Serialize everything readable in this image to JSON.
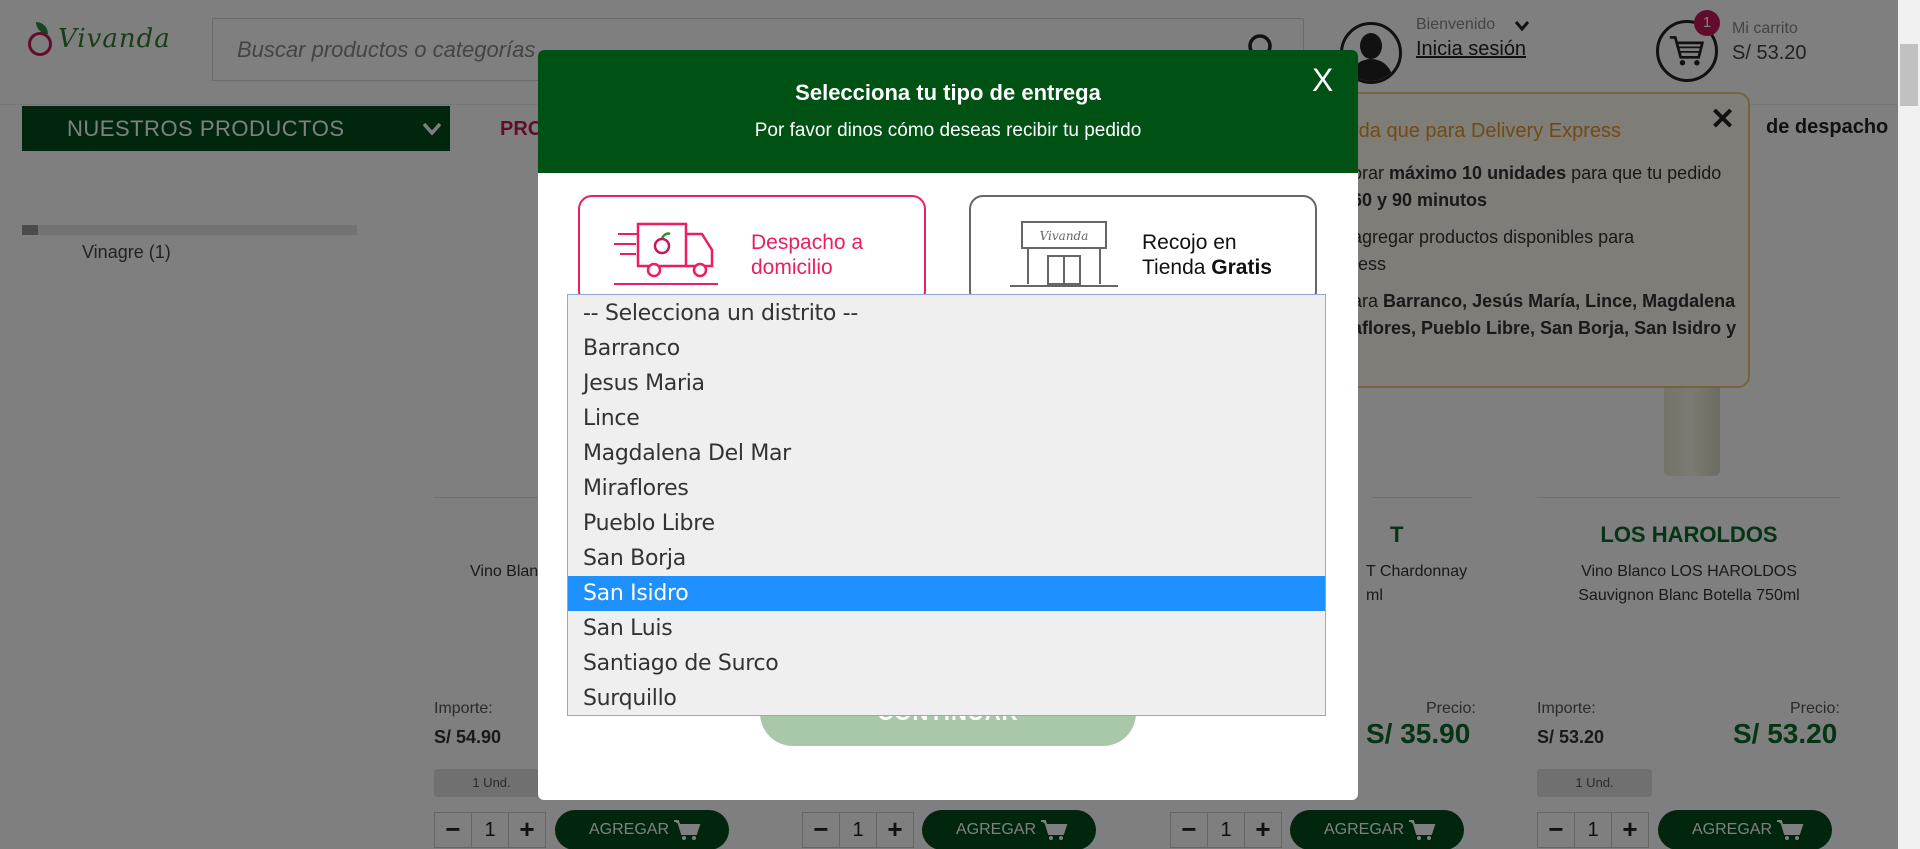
{
  "header": {
    "logo_text": "Vivanda",
    "search_placeholder": "Buscar productos o categorías",
    "welcome": "Bienvenido",
    "login": "Inicia sesión",
    "cart_label": "Mi carrito",
    "cart_total": "S/ 53.20",
    "cart_count": "1"
  },
  "nav": {
    "products_menu": "NUESTROS PRODUCTOS",
    "promo_link": "PRO",
    "dispatch_link": "de despacho"
  },
  "filters": {
    "vinagre": "Vinagre (1)"
  },
  "tooltip": {
    "title": "rda que para Delivery Express",
    "line1_a": "orar ",
    "line1_b": "máximo 10 unidades",
    "line1_c": " para que tu pedido",
    "line2": "60 y 90 minutos",
    "line3": "agregar productos disponibles para",
    "line4": "ress",
    "line5_a": "ara ",
    "line5_b": "Barranco, Jesús María, Lince, Magdalena",
    "line6": "aflores, Pueblo Libre, San Borja, San Isidro y"
  },
  "products": [
    {
      "brand": "",
      "name_line1": "Vino Blan",
      "name_line2": "",
      "importe_label": "Importe:",
      "importe": "S/ 54.90",
      "precio_label": "",
      "precio": "",
      "unit": "1 Und.",
      "qty": "1",
      "add_label": "AGREGAR"
    },
    {
      "brand": "",
      "name_line1": "",
      "name_line2": "",
      "importe_label": "",
      "importe": "",
      "precio_label": "",
      "precio": "",
      "unit": "",
      "qty": "1",
      "add_label": "AGREGAR"
    },
    {
      "brand": "T",
      "name_line1": "T Chardonnay",
      "name_line2": "ml",
      "importe_label": "",
      "importe": "",
      "precio_label": "Precio:",
      "precio": "S/ 35.90",
      "unit": "",
      "qty": "1",
      "add_label": "AGREGAR"
    },
    {
      "brand": "LOS HAROLDOS",
      "name_line1": "Vino Blanco LOS HAROLDOS",
      "name_line2": "Sauvignon Blanc Botella 750ml",
      "importe_label": "Importe:",
      "importe": "S/ 53.20",
      "precio_label": "Precio:",
      "precio": "S/ 53.20",
      "unit": "1 Und.",
      "qty": "1",
      "add_label": "AGREGAR"
    }
  ],
  "modal": {
    "title": "Selecciona tu tipo de entrega",
    "subtitle": "Por favor dinos cómo deseas recibir tu pedido",
    "close": "X",
    "delivery_line1": "Despacho a",
    "delivery_line2": "domicilio",
    "pickup_line1": "Recojo en",
    "pickup_line2a": "Tienda ",
    "pickup_line2b": "Gratis",
    "store_sign": "Vivanda",
    "continue": "CONTINUAR"
  },
  "district_dropdown": {
    "options": [
      "-- Selecciona un distrito --",
      "Barranco",
      "Jesus Maria",
      "Lince",
      "Magdalena Del Mar",
      "Miraflores",
      "Pueblo Libre",
      "San Borja",
      "San Isidro",
      "San Luis",
      "Santiago de Surco",
      "Surquillo"
    ],
    "highlighted": "San Isidro"
  },
  "colors": {
    "brand_green": "#005114",
    "accent_pink": "#e91e63",
    "highlight_blue": "#1e90ff",
    "price_green": "#0a6b2a"
  }
}
